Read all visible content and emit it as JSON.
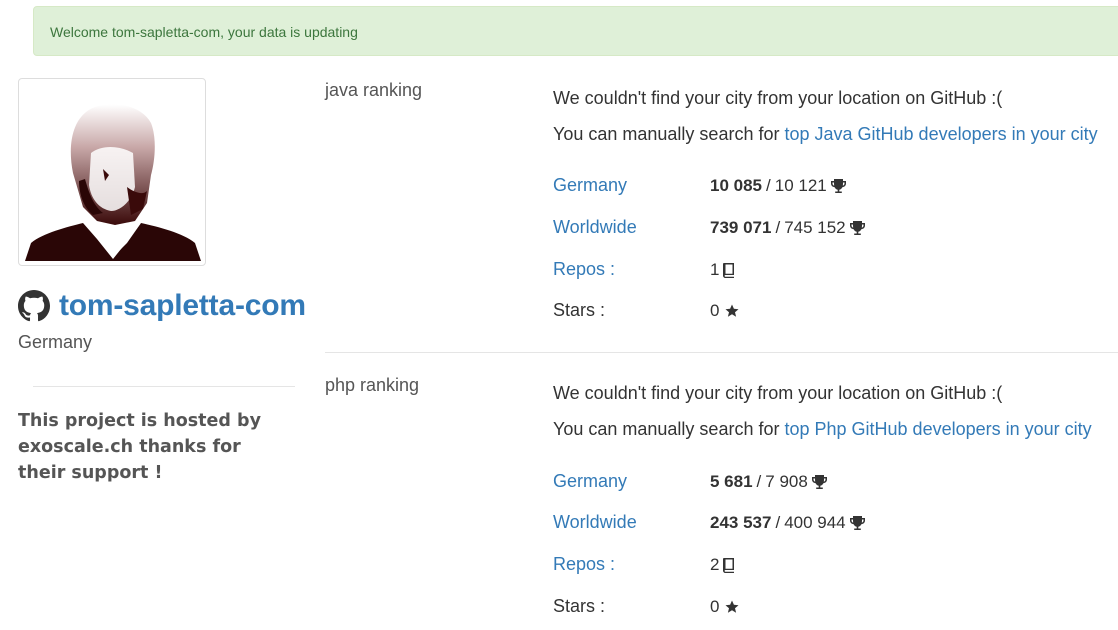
{
  "alert": {
    "message": "Welcome tom-sapletta-com, your data is updating"
  },
  "profile": {
    "username": "tom-sapletta-com",
    "location": "Germany",
    "hosted_text": "This project is hosted by exoscale.ch thanks for their support !"
  },
  "java": {
    "title": "java ranking",
    "city_msg": "We couldn't find your city from your location on GitHub :(",
    "search_prefix": "You can manually search for",
    "search_link": "top Java GitHub developers in your city",
    "country_label": "Germany",
    "country_rank": "10 085",
    "country_total": "10 121",
    "world_label": "Worldwide",
    "world_rank": "739 071",
    "world_total": "745 152",
    "repos_label": "Repos :",
    "repos_value": "1",
    "stars_label": "Stars :",
    "stars_value": "0"
  },
  "php": {
    "title": "php ranking",
    "city_msg": "We couldn't find your city from your location on GitHub :(",
    "search_prefix": "You can manually search for",
    "search_link": "top Php GitHub developers in your city",
    "country_label": "Germany",
    "country_rank": "5 681",
    "country_total": "7 908",
    "world_label": "Worldwide",
    "world_rank": "243 537",
    "world_total": "400 944",
    "repos_label": "Repos :",
    "repos_value": "2",
    "stars_label": "Stars :",
    "stars_value": "0"
  },
  "icons": {
    "github": "github-octocat-icon",
    "trophy": "trophy-icon",
    "repo": "book-icon",
    "star": "star-icon"
  },
  "colors": {
    "link": "#337ab7",
    "alert_bg": "#dff0d8",
    "alert_text": "#3c763d"
  }
}
